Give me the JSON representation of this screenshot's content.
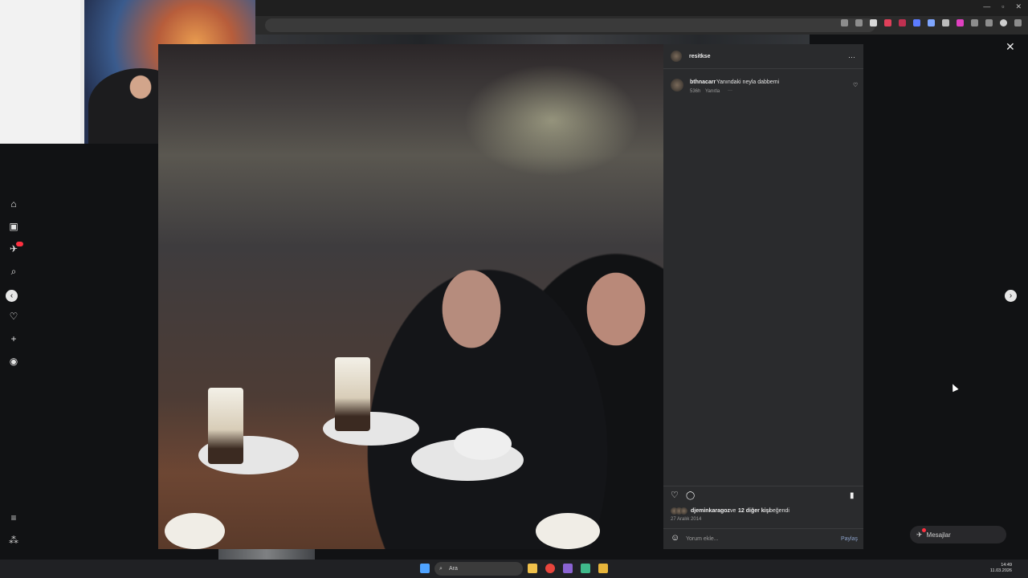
{
  "post": {
    "owner": "resitkse",
    "more_label": "···",
    "comment": {
      "user": "bthnacarr",
      "text": "Yanındaki neyla dabbemi",
      "age": "536h",
      "reply_label": "Yanıtla",
      "more": "···"
    },
    "likes": {
      "liked_by": "djeminkaragoz",
      "and_label": "ve",
      "others": "12 diğer kişi",
      "suffix": "beğendi"
    },
    "date": "27 Aralık 2014",
    "comment_placeholder": "Yorum ekle...",
    "share_label": "Paylaş"
  },
  "messages": {
    "label": "Mesajlar"
  },
  "taskbar": {
    "search_placeholder": "Ara",
    "time": "14:49",
    "date": "11.03.2026"
  },
  "icons": {
    "close": "✕",
    "next": "›",
    "prev": "‹",
    "like": "♡",
    "comment": "◯",
    "save": "▮",
    "emoji": "☺",
    "small_heart": "♡"
  },
  "colors": {
    "panel_bg": "#2a2b2d",
    "notification_red": "#ff3040",
    "taskbar_bg": "#202124"
  }
}
